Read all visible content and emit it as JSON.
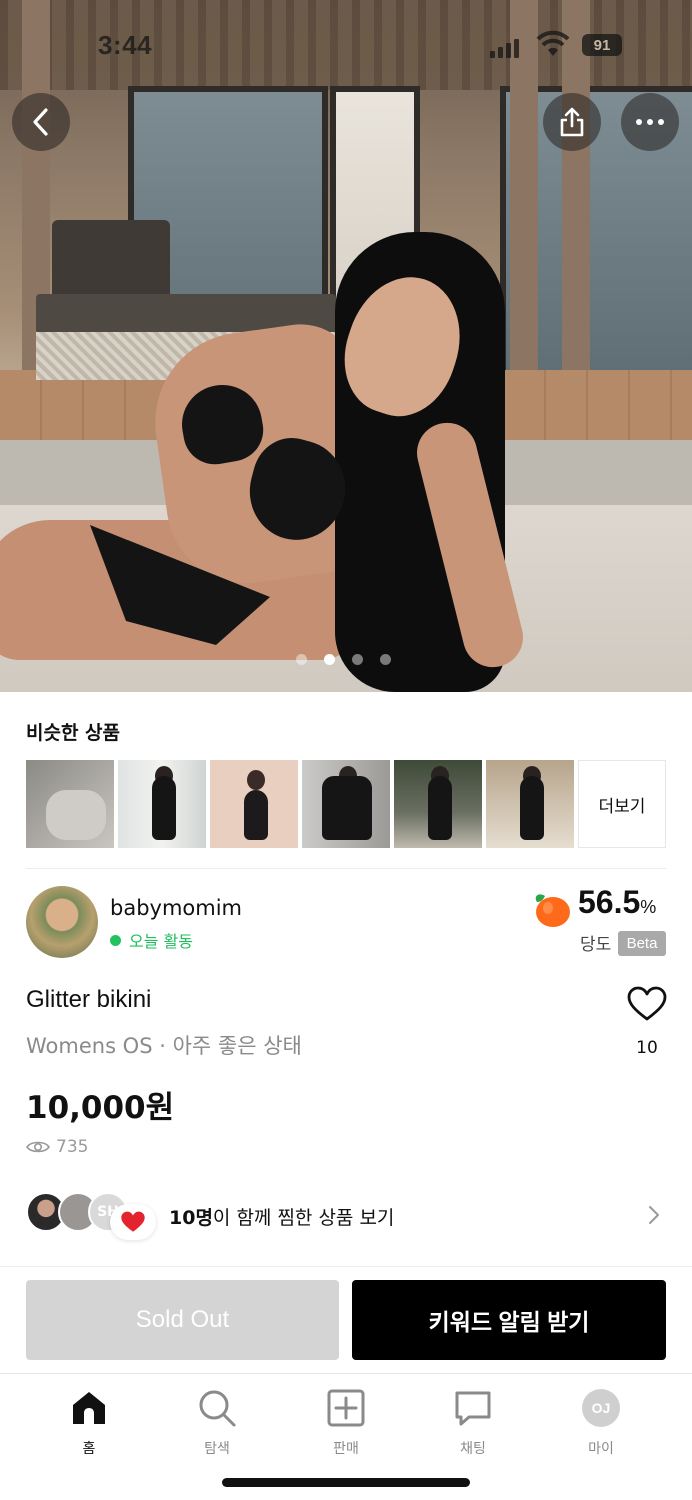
{
  "status": {
    "time": "3:44",
    "battery": "91"
  },
  "hero": {
    "active_dot": 1,
    "dot_count": 4
  },
  "similar": {
    "title": "비슷한 상품",
    "more_label": "더보기"
  },
  "seller": {
    "name": "babymomim",
    "activity": "오늘 활동",
    "rating_value": "56.5",
    "rating_unit": "%",
    "rating_label": "당도",
    "beta_label": "Beta"
  },
  "product": {
    "title": "Glitter bikini",
    "meta": "Womens OS · 아주 좋은 상태",
    "price": "10,000원",
    "views": "735",
    "likes": "10"
  },
  "wish": {
    "avatar3_text": "SH",
    "count": "10명",
    "text": "이 함께 찜한 상품 보기"
  },
  "actions": {
    "sold_out": "Sold Out",
    "keyword_alert": "키워드 알림 받기"
  },
  "tabs": [
    {
      "label": "홈",
      "icon": "home-icon",
      "active": true
    },
    {
      "label": "탐색",
      "icon": "search-icon"
    },
    {
      "label": "판매",
      "icon": "plus-square-icon"
    },
    {
      "label": "채팅",
      "icon": "chat-bubble-icon"
    },
    {
      "label": "마이",
      "icon": "profile-initials",
      "initials": "OJ"
    }
  ],
  "colors": {
    "accent_green": "#22c35e",
    "primary_button": "#000000",
    "disabled_button": "#d4d4d4",
    "peach": "#ff6a1a"
  }
}
